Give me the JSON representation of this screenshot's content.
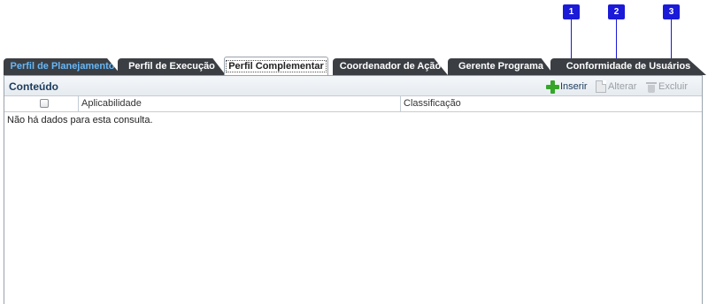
{
  "markers": [
    {
      "number": "1",
      "target": "Inserir"
    },
    {
      "number": "2",
      "target": "Alterar"
    },
    {
      "number": "3",
      "target": "Excluir"
    }
  ],
  "tabs": [
    {
      "label": "Perfil de Planejamento",
      "active": false
    },
    {
      "label": "Perfil de Execução",
      "active": false
    },
    {
      "label": "Perfil Complementar",
      "active": true
    },
    {
      "label": "Coordenador de Ação",
      "active": false
    },
    {
      "label": "Gerente Programa",
      "active": false
    },
    {
      "label": "Conformidade de Usuários",
      "active": false
    }
  ],
  "panel": {
    "title": "Conteúdo",
    "toolbar": {
      "insert": {
        "label": "Inserir",
        "icon": "plus-icon",
        "enabled": true
      },
      "alter": {
        "label": "Alterar",
        "icon": "document-icon",
        "enabled": false
      },
      "delete": {
        "label": "Excluir",
        "icon": "trash-icon",
        "enabled": false
      }
    }
  },
  "table": {
    "columns": [
      "Aplicabilidade",
      "Classificação"
    ],
    "empty_message": "Não há dados para esta consulta."
  },
  "colors": {
    "tab_dark": "#3b3f44",
    "tab_first_text": "#67b7f7",
    "marker_blue": "#1a1ad8",
    "insert_green": "#36a62a",
    "title_text": "#1b3a5c"
  }
}
